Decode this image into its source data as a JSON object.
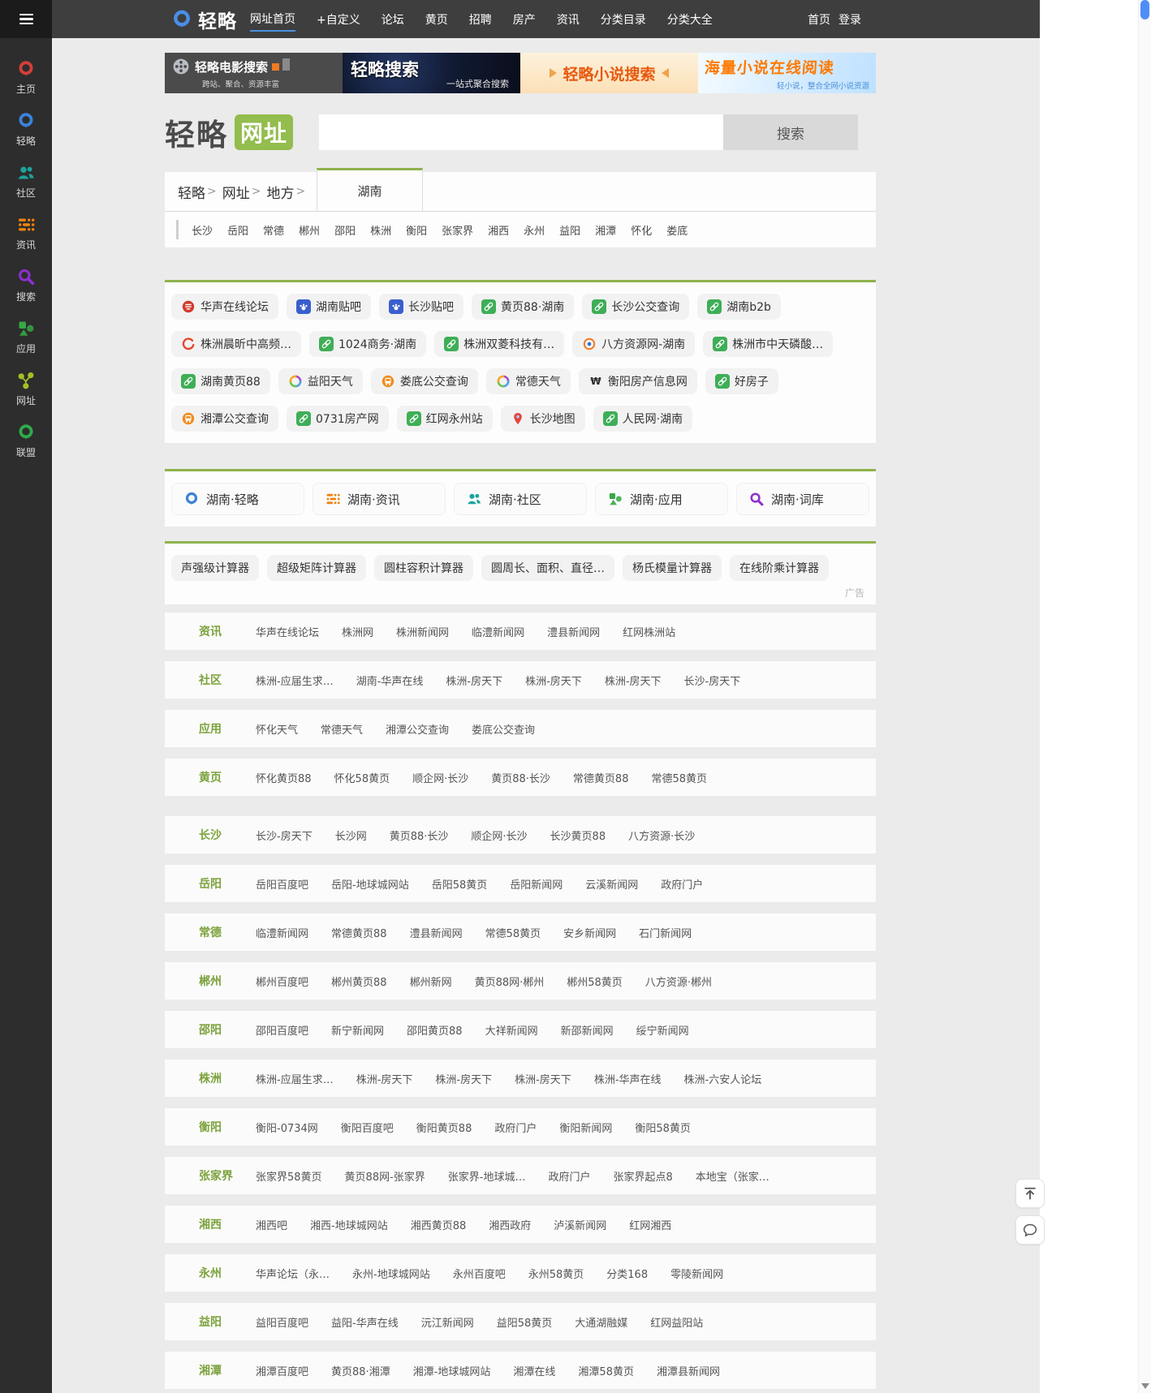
{
  "colors": {
    "accent_green": "#8fb24c",
    "brand_blue": "#4a8ee8",
    "navbar_bg": "#3e3e3e",
    "sidebar_bg": "#2d2d2d",
    "page_bg": "#ebebeb",
    "active_underline": "#4a90e2"
  },
  "sidebar": {
    "items": [
      {
        "label": "主页",
        "icon": "q-ring",
        "color": "#d43f3a"
      },
      {
        "label": "轻略",
        "icon": "q-ring",
        "color": "#3b82d8"
      },
      {
        "label": "社区",
        "icon": "people",
        "color": "#1ba39c"
      },
      {
        "label": "资讯",
        "icon": "grid",
        "color": "#f0830d"
      },
      {
        "label": "搜索",
        "icon": "magnifier",
        "color": "#8e2fd0"
      },
      {
        "label": "应用",
        "icon": "shapes",
        "color": "#36a845"
      },
      {
        "label": "网址",
        "icon": "share",
        "color": "#a3c122"
      },
      {
        "label": "联盟",
        "icon": "q-ring",
        "color": "#2faa4a"
      }
    ]
  },
  "navbar": {
    "logo": "轻略",
    "items": [
      "网址首页",
      "+自定义",
      "论坛",
      "黄页",
      "招聘",
      "房产",
      "资讯",
      "分类目录",
      "分类大全"
    ],
    "right_links": [
      "首页",
      "登录"
    ]
  },
  "banners": [
    {
      "title": "轻略电影搜索",
      "subtitle": "跨站、聚合、资源丰富"
    },
    {
      "title": "轻略搜索",
      "subtitle": "一站式聚合搜索"
    },
    {
      "title": "轻略小说搜索",
      "subtitle": ""
    },
    {
      "title": "海量小说在线阅读",
      "subtitle": "轻小说，整合全网小说资源"
    }
  ],
  "hero": {
    "logo_text": "轻略",
    "logo_badge": "网址",
    "search_value": "",
    "search_button": "搜索"
  },
  "breadcrumb": {
    "items": [
      "轻略",
      "网址",
      "地方"
    ],
    "separator": ">",
    "active_tab": "湖南"
  },
  "cities": [
    "长沙",
    "岳阳",
    "常德",
    "郴州",
    "邵阳",
    "株洲",
    "衡阳",
    "张家界",
    "湘西",
    "永州",
    "益阳",
    "湘潭",
    "怀化",
    "娄底"
  ],
  "quick_links": [
    {
      "icon": "huasheng",
      "text": "华声在线论坛"
    },
    {
      "icon": "tieba-paw",
      "text": "湖南贴吧"
    },
    {
      "icon": "tieba-paw",
      "text": "长沙贴吧"
    },
    {
      "icon": "link",
      "text": "黄页88·湖南"
    },
    {
      "icon": "link",
      "text": "长沙公交查询"
    },
    {
      "icon": "link",
      "text": "湖南b2b"
    },
    {
      "icon": "arc",
      "text": "株洲晨昕中高频…"
    },
    {
      "icon": "link",
      "text": "1024商务·湖南"
    },
    {
      "icon": "link",
      "text": "株洲双菱科技有…"
    },
    {
      "icon": "eye",
      "text": "八方资源网-湖南"
    },
    {
      "icon": "link",
      "text": "株洲市中天磷酸…"
    },
    {
      "icon": "link",
      "text": "湖南黄页88"
    },
    {
      "icon": "swirl",
      "text": "益阳天气"
    },
    {
      "icon": "bus",
      "text": "娄底公交查询"
    },
    {
      "icon": "swirl",
      "text": "常德天气"
    },
    {
      "icon": "won",
      "text": "衡阳房产信息网"
    },
    {
      "icon": "link",
      "text": "好房子"
    },
    {
      "icon": "bus",
      "text": "湘潭公交查询"
    },
    {
      "icon": "link",
      "text": "0731房产网"
    },
    {
      "icon": "link",
      "text": "红网永州站"
    },
    {
      "icon": "pin",
      "text": "长沙地图"
    },
    {
      "icon": "link",
      "text": "人民网·湖南"
    }
  ],
  "hub_links": [
    {
      "icon": "q-ring",
      "color": "#3b82d8",
      "text": "湖南·轻略"
    },
    {
      "icon": "grid",
      "color": "#f0830d",
      "text": "湖南·资讯"
    },
    {
      "icon": "people",
      "color": "#1ba39c",
      "text": "湖南·社区"
    },
    {
      "icon": "shapes",
      "color": "#36a845",
      "text": "湖南·应用"
    },
    {
      "icon": "magnifier",
      "color": "#8e2fd0",
      "text": "湖南·词库"
    }
  ],
  "ad_row": {
    "items": [
      "声强级计算器",
      "超级矩阵计算器",
      "圆柱容积计算器",
      "圆周长、面积、直径…",
      "杨氏模量计算器",
      "在线阶乘计算器"
    ],
    "label": "广告"
  },
  "category_table": [
    {
      "label": "资讯",
      "links": [
        "华声在线论坛",
        "株洲网",
        "株洲新闻网",
        "临澧新闻网",
        "澧县新闻网",
        "红网株洲站"
      ]
    },
    {
      "label": "社区",
      "links": [
        "株洲-应届生求…",
        "湖南-华声在线",
        "株洲-房天下",
        "株洲-房天下",
        "株洲-房天下",
        "长沙-房天下"
      ]
    },
    {
      "label": "应用",
      "links": [
        "怀化天气",
        "常德天气",
        "湘潭公交查询",
        "娄底公交查询"
      ]
    },
    {
      "label": "黄页",
      "links": [
        "怀化黄页88",
        "怀化58黄页",
        "顺企网·长沙",
        "黄页88·长沙",
        "常德黄页88",
        "常德58黄页"
      ]
    }
  ],
  "city_table": [
    {
      "label": "长沙",
      "links": [
        "长沙-房天下",
        "长沙网",
        "黄页88·长沙",
        "顺企网·长沙",
        "长沙黄页88",
        "八方资源·长沙"
      ]
    },
    {
      "label": "岳阳",
      "links": [
        "岳阳百度吧",
        "岳阳-地球城网站",
        "岳阳58黄页",
        "岳阳新闻网",
        "云溪新闻网",
        "政府门户"
      ]
    },
    {
      "label": "常德",
      "links": [
        "临澧新闻网",
        "常德黄页88",
        "澧县新闻网",
        "常德58黄页",
        "安乡新闻网",
        "石门新闻网"
      ]
    },
    {
      "label": "郴州",
      "links": [
        "郴州百度吧",
        "郴州黄页88",
        "郴州新网",
        "黄页88网·郴州",
        "郴州58黄页",
        "八方资源·郴州"
      ]
    },
    {
      "label": "邵阳",
      "links": [
        "邵阳百度吧",
        "新宁新闻网",
        "邵阳黄页88",
        "大祥新闻网",
        "新邵新闻网",
        "绥宁新闻网"
      ]
    },
    {
      "label": "株洲",
      "links": [
        "株洲-应届生求…",
        "株洲-房天下",
        "株洲-房天下",
        "株洲-房天下",
        "株洲-华声在线",
        "株洲-六安人论坛"
      ]
    },
    {
      "label": "衡阳",
      "links": [
        "衡阳-0734网",
        "衡阳百度吧",
        "衡阳黄页88",
        "政府门户",
        "衡阳新闻网",
        "衡阳58黄页"
      ]
    },
    {
      "label": "张家界",
      "links": [
        "张家界58黄页",
        "黄页88网-张家界",
        "张家界-地球城…",
        "政府门户",
        "张家界起点8",
        "本地宝（张家…"
      ]
    },
    {
      "label": "湘西",
      "links": [
        "湘西吧",
        "湘西-地球城网站",
        "湘西黄页88",
        "湘西政府",
        "泸溪新闻网",
        "红网湘西"
      ]
    },
    {
      "label": "永州",
      "links": [
        "华声论坛（永…",
        "永州-地球城网站",
        "永州百度吧",
        "永州58黄页",
        "分类168",
        "零陵新闻网"
      ]
    },
    {
      "label": "益阳",
      "links": [
        "益阳百度吧",
        "益阳-华声在线",
        "沅江新闻网",
        "益阳58黄页",
        "大通湖融媒",
        "红网益阳站"
      ]
    },
    {
      "label": "湘潭",
      "links": [
        "湘潭百度吧",
        "黄页88·湘潭",
        "湘潭-地球城网站",
        "湘潭在线",
        "湘潭58黄页",
        "湘潭县新闻网"
      ]
    }
  ]
}
